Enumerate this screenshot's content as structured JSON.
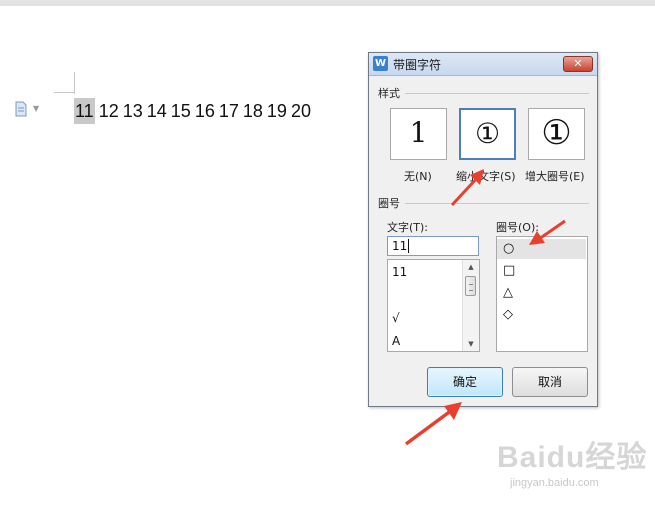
{
  "document": {
    "numbers": [
      "11",
      "12",
      "13",
      "14",
      "15",
      "16",
      "17",
      "18",
      "19",
      "20"
    ],
    "selected_index": 0
  },
  "dialog": {
    "title": "带圈字符",
    "close_glyph": "✕",
    "style_group": "样式",
    "styles": [
      {
        "label": "无(N)",
        "glyph": "1"
      },
      {
        "label": "缩小文字(S)",
        "glyph": "①"
      },
      {
        "label": "增大圈号(E)",
        "glyph": "①"
      }
    ],
    "selected_style": 1,
    "circle_group": "圈号",
    "text_label": "文字(T):",
    "text_value": "11",
    "text_list": [
      "11",
      "",
      "√",
      "A"
    ],
    "circle_label": "圈号(O):",
    "shapes": [
      "○",
      "□",
      "△",
      "◇"
    ],
    "selected_shape": 0,
    "ok_label": "确定",
    "cancel_label": "取消"
  },
  "watermark": {
    "brand": "Baidu经验",
    "url": "jingyan.baidu.com"
  },
  "colors": {
    "accent": "#3c7fb1",
    "arrow": "#e8402f",
    "close": "#c9432f"
  }
}
